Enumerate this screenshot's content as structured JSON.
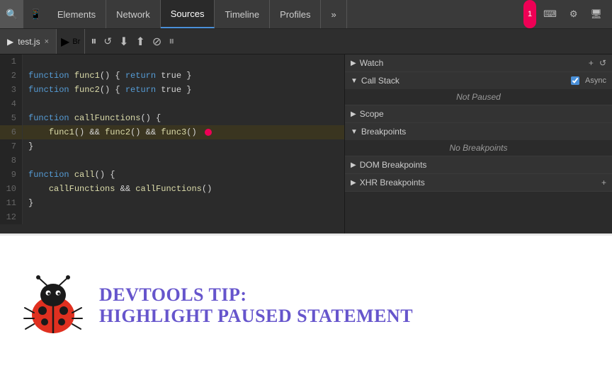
{
  "header": {
    "tabs": [
      {
        "label": "Elements",
        "active": false
      },
      {
        "label": "Network",
        "active": false
      },
      {
        "label": "Sources",
        "active": true
      },
      {
        "label": "Timeline",
        "active": false
      },
      {
        "label": "Profiles",
        "active": false
      }
    ],
    "more_label": "»",
    "counter": "1",
    "icons": [
      "search",
      "mobile",
      "settings",
      "monitor"
    ]
  },
  "file_tab": {
    "name": "test.js",
    "close": "×"
  },
  "debug": {
    "pause": "⏸",
    "step_over": "↺",
    "step_into": "↓",
    "step_out": "↑",
    "deactivate": "⊘",
    "pause2": "⏸"
  },
  "right_panel": {
    "watch": {
      "label": "Watch",
      "add": "+",
      "refresh": "↺"
    },
    "call_stack": {
      "label": "Call Stack",
      "async_label": "Async",
      "status": "Not Paused"
    },
    "scope": {
      "label": "Scope"
    },
    "breakpoints": {
      "label": "Breakpoints",
      "status": "No Breakpoints"
    },
    "dom_breakpoints": {
      "label": "DOM Breakpoints"
    },
    "xhr_breakpoints": {
      "label": "XHR Breakpoints"
    }
  },
  "code": {
    "lines": [
      {
        "num": "1",
        "code": ""
      },
      {
        "num": "2",
        "code": "function func1() { return true }"
      },
      {
        "num": "3",
        "code": "function func2() { return true }"
      },
      {
        "num": "4",
        "code": ""
      },
      {
        "num": "5",
        "code": "function callFunctions() {"
      },
      {
        "num": "6",
        "code": "    func1() && func2() && func3()",
        "highlight": true,
        "error": true
      },
      {
        "num": "7",
        "code": "}"
      },
      {
        "num": "8",
        "code": ""
      },
      {
        "num": "9",
        "code": "function call() {"
      },
      {
        "num": "10",
        "code": "    callFunctions && callFunctions()"
      },
      {
        "num": "11",
        "code": "}"
      },
      {
        "num": "12",
        "code": ""
      }
    ]
  },
  "tip": {
    "title_line1": "DevTools Tip:",
    "title_line2": "Highlight Paused Statement"
  }
}
